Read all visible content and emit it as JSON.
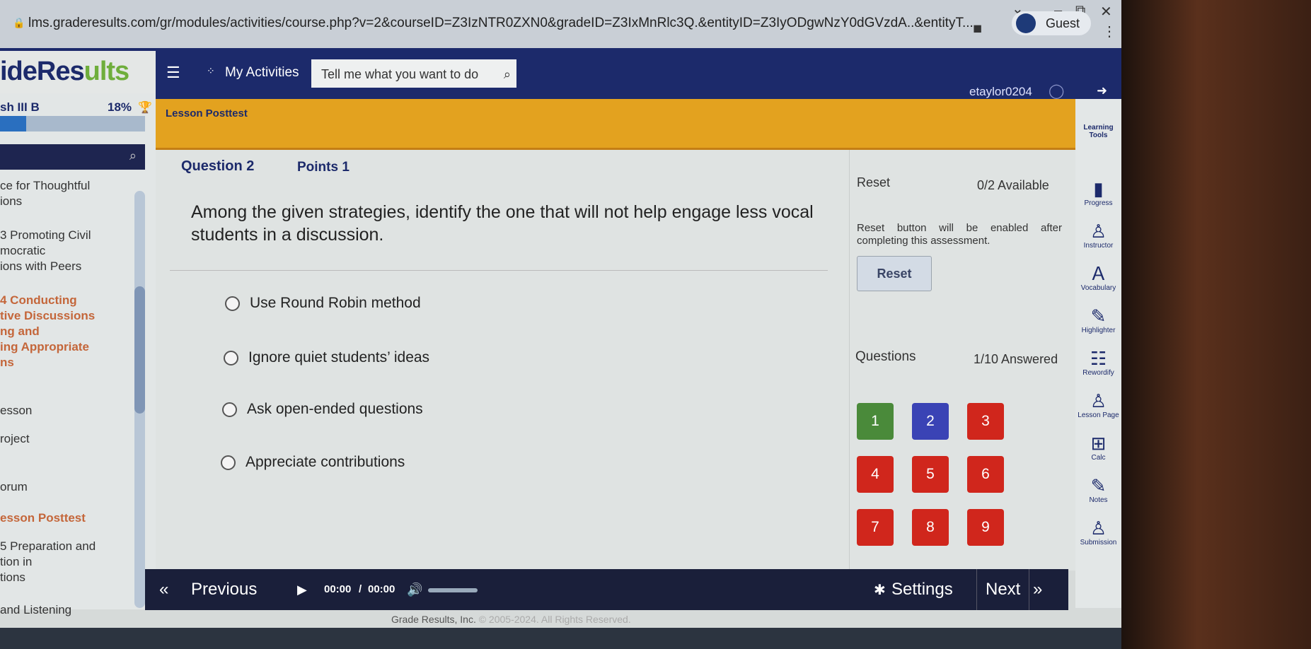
{
  "browser": {
    "url": "lms.graderesults.com/gr/modules/activities/course.php?v=2&courseID=Z3IzNTR0ZXN0&gradeID=Z3IxMnRlc3Q.&entityID=Z3IyODgwNzY0dGVzdA..&entityT...",
    "profile": "Guest"
  },
  "header": {
    "logo_a": "ideRes",
    "logo_b": "ults",
    "my_activities": "My Activities",
    "search_placeholder": "Tell me what you want to do",
    "username": "etaylor0204"
  },
  "sidebar": {
    "course": "sh III B",
    "percent": "18%",
    "progress": 18,
    "items": [
      {
        "label": "ce for Thoughtful\nions",
        "active": false
      },
      {
        "label": "3 Promoting Civil\nmocratic\nions with Peers",
        "active": false
      },
      {
        "label": "4 Conducting\ntive Discussions\nng and\ning Appropriate\nns",
        "active": true
      },
      {
        "label": "esson",
        "active": false
      },
      {
        "label": "roject",
        "active": false
      },
      {
        "label": "orum",
        "active": false
      },
      {
        "label": "esson Posttest",
        "active": true
      },
      {
        "label": "5 Preparation and\ntion in\ntions",
        "active": false
      },
      {
        "label": "and Listening",
        "active": false
      }
    ]
  },
  "lesson": {
    "title": "Lesson Posttest"
  },
  "question": {
    "label": "Question 2",
    "points": "Points 1",
    "text": "Among the given strategies, identify the one that will not help engage less vocal students in a discussion.",
    "options": [
      "Use Round Robin method",
      "Ignore quiet students’ ideas",
      "Ask open-ended questions",
      "Appreciate contributions"
    ]
  },
  "reset_panel": {
    "title": "Reset",
    "available": "0/2 Available",
    "note": "Reset button will be enabled after completing this assessment.",
    "button": "Reset"
  },
  "questions_panel": {
    "title": "Questions",
    "answered": "1/10 Answered",
    "buttons": [
      {
        "n": "1",
        "status": "answered",
        "color": "#4a8a3a"
      },
      {
        "n": "2",
        "status": "current",
        "color": "#3a43b5"
      },
      {
        "n": "3",
        "status": "unanswered",
        "color": "#d0261c"
      },
      {
        "n": "4",
        "status": "unanswered",
        "color": "#d0261c"
      },
      {
        "n": "5",
        "status": "unanswered",
        "color": "#d0261c"
      },
      {
        "n": "6",
        "status": "unanswered",
        "color": "#d0261c"
      },
      {
        "n": "7",
        "status": "unanswered",
        "color": "#d0261c"
      },
      {
        "n": "8",
        "status": "unanswered",
        "color": "#d0261c"
      },
      {
        "n": "9",
        "status": "unanswered",
        "color": "#d0261c"
      }
    ]
  },
  "tools": [
    "Learning Tools",
    "Progress",
    "Instructor",
    "Vocabulary",
    "Highlighter",
    "Rewordify",
    "Lesson Page",
    "Calc",
    "Notes",
    "Submission"
  ],
  "player": {
    "previous": "Previous",
    "current": "00:00",
    "separator": "/",
    "duration": "00:00",
    "settings": "Settings",
    "next": "Next"
  },
  "footer": {
    "company": "Grade Results, Inc.",
    "copyright": "© 2005-2024. All Rights Reserved."
  }
}
